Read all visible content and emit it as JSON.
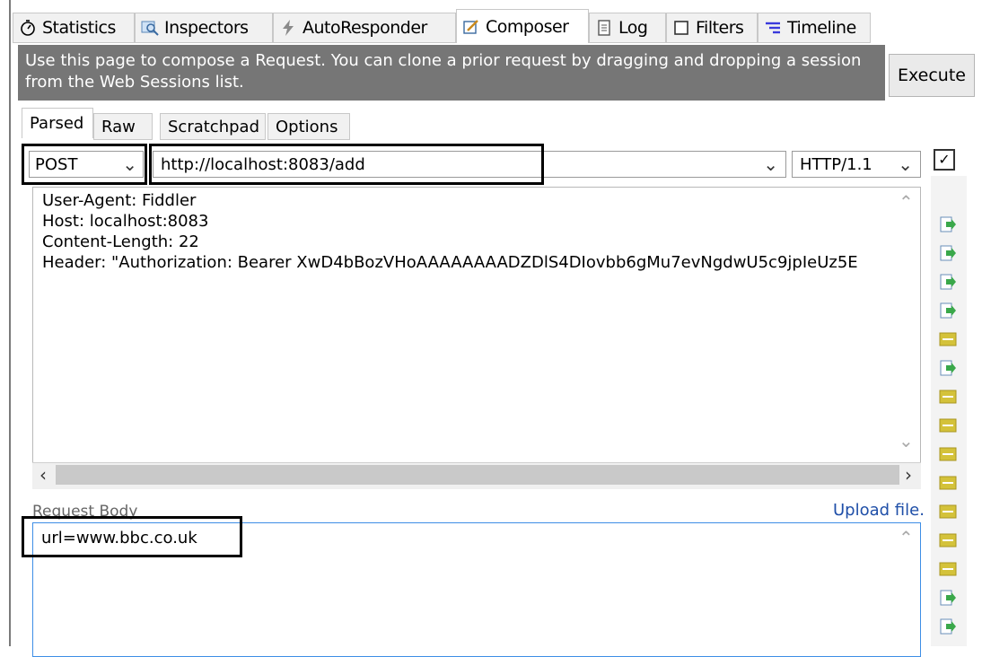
{
  "tabs": [
    {
      "label": "Statistics",
      "icon": "stopwatch-icon"
    },
    {
      "label": "Inspectors",
      "icon": "magnifier-icon"
    },
    {
      "label": "AutoResponder",
      "icon": "lightning-icon"
    },
    {
      "label": "Composer",
      "icon": "compose-icon"
    },
    {
      "label": "Log",
      "icon": "log-icon"
    },
    {
      "label": "Filters",
      "icon": "checkbox-icon"
    },
    {
      "label": "Timeline",
      "icon": "timeline-icon"
    }
  ],
  "banner": {
    "text": "Use this page to compose a Request. You can clone a prior request by dragging and dropping a session from the Web Sessions list.",
    "execute_label": "Execute"
  },
  "subtabs": [
    "Parsed",
    "Raw",
    "Scratchpad",
    "Options"
  ],
  "request": {
    "method": "POST",
    "url": "http://localhost:8083/add",
    "protocol": "HTTP/1.1"
  },
  "headers": [
    "User-Agent: Fiddler",
    "Host: localhost:8083",
    "Content-Length: 22",
    "Header: \"Authorization: Bearer XwD4bBozVHoAAAAAAAADZDlS4DIovbb6gMu7evNgdwU5c9jpIeUz5E"
  ],
  "body": {
    "label": "Request Body",
    "upload_label": "Upload file.",
    "text": "url=www.bbc.co.uk"
  },
  "colors": {
    "banner": "#767676",
    "highlight_border": "#000000",
    "link": "#1f4fa8",
    "body_border": "#3d8ee6"
  }
}
